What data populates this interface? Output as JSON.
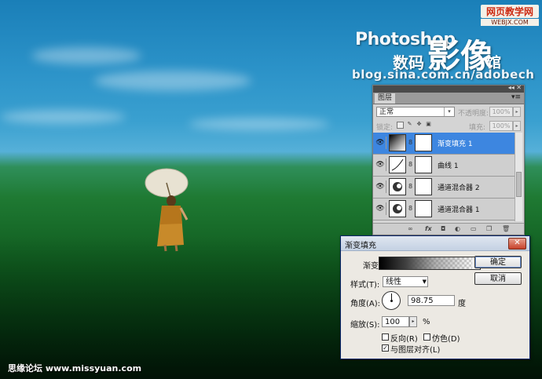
{
  "watermark": {
    "photoshop": "Photoshop",
    "shuma": "数码",
    "yingxiang": "影像",
    "guan": "馆",
    "blog": "blog.sina.com.cn/adobech",
    "corner_line1": "网页教学网",
    "corner_line2": "WEBJX.COM",
    "bottom": "思缘论坛 www.missyuan.com"
  },
  "layers_panel": {
    "tab": "图层",
    "collapse_icon": "◂◂ ✕",
    "menu_icon": "▾≡",
    "blend_mode": "正常",
    "opacity_label": "不透明度:",
    "opacity_value": "100%",
    "lock_label": "锁定:",
    "fill_label": "填充:",
    "fill_value": "100%",
    "layers": [
      {
        "name": "渐变填充 1",
        "selected": true,
        "thumb": "gradient-fill-icon"
      },
      {
        "name": "曲线 1",
        "selected": false,
        "thumb": "curves-icon"
      },
      {
        "name": "通道混合器 2",
        "selected": false,
        "thumb": "channel-mixer-icon"
      },
      {
        "name": "通道混合器 1",
        "selected": false,
        "thumb": "channel-mixer-icon"
      }
    ],
    "footer_icons": [
      "link-icon",
      "fx-icon",
      "mask-icon",
      "adjustment-icon",
      "folder-icon",
      "new-layer-icon",
      "trash-icon"
    ]
  },
  "gradient_dialog": {
    "title": "渐变填充",
    "gradient_label": "渐变:",
    "style_label": "样式(T):",
    "style_value": "线性",
    "angle_label": "角度(A):",
    "angle_value": "98.75",
    "angle_unit": "度",
    "scale_label": "缩放(S):",
    "scale_value": "100",
    "scale_unit": "%",
    "reverse_label": "反向(R)",
    "reverse_checked": false,
    "dither_label": "仿色(D)",
    "dither_checked": false,
    "align_label": "与图层对齐(L)",
    "align_checked": true,
    "ok_label": "确定",
    "cancel_label": "取消"
  },
  "colors": {
    "selection": "#3d86e0",
    "sky": "#2b92c8",
    "grass": "#1f7a33"
  }
}
